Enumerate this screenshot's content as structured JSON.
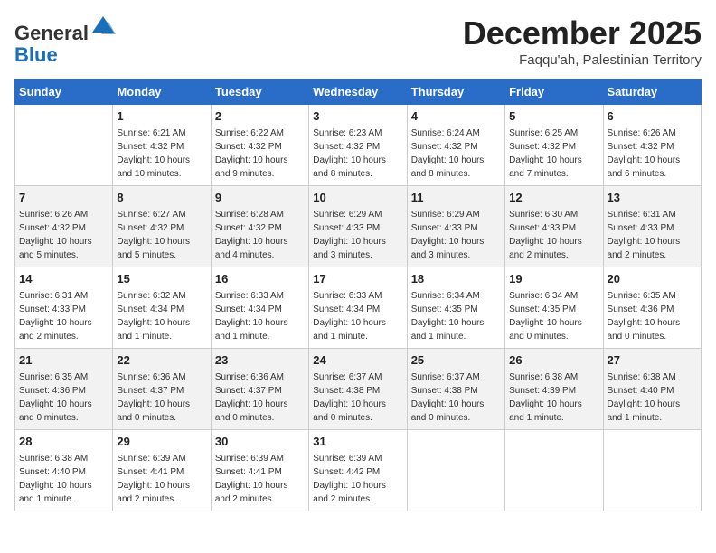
{
  "header": {
    "logo_general": "General",
    "logo_blue": "Blue",
    "month_title": "December 2025",
    "location": "Faqqu'ah, Palestinian Territory"
  },
  "columns": [
    "Sunday",
    "Monday",
    "Tuesday",
    "Wednesday",
    "Thursday",
    "Friday",
    "Saturday"
  ],
  "weeks": [
    {
      "days": [
        {
          "num": "",
          "info": ""
        },
        {
          "num": "1",
          "info": "Sunrise: 6:21 AM\nSunset: 4:32 PM\nDaylight: 10 hours\nand 10 minutes."
        },
        {
          "num": "2",
          "info": "Sunrise: 6:22 AM\nSunset: 4:32 PM\nDaylight: 10 hours\nand 9 minutes."
        },
        {
          "num": "3",
          "info": "Sunrise: 6:23 AM\nSunset: 4:32 PM\nDaylight: 10 hours\nand 8 minutes."
        },
        {
          "num": "4",
          "info": "Sunrise: 6:24 AM\nSunset: 4:32 PM\nDaylight: 10 hours\nand 8 minutes."
        },
        {
          "num": "5",
          "info": "Sunrise: 6:25 AM\nSunset: 4:32 PM\nDaylight: 10 hours\nand 7 minutes."
        },
        {
          "num": "6",
          "info": "Sunrise: 6:26 AM\nSunset: 4:32 PM\nDaylight: 10 hours\nand 6 minutes."
        }
      ]
    },
    {
      "days": [
        {
          "num": "7",
          "info": "Sunrise: 6:26 AM\nSunset: 4:32 PM\nDaylight: 10 hours\nand 5 minutes."
        },
        {
          "num": "8",
          "info": "Sunrise: 6:27 AM\nSunset: 4:32 PM\nDaylight: 10 hours\nand 5 minutes."
        },
        {
          "num": "9",
          "info": "Sunrise: 6:28 AM\nSunset: 4:32 PM\nDaylight: 10 hours\nand 4 minutes."
        },
        {
          "num": "10",
          "info": "Sunrise: 6:29 AM\nSunset: 4:33 PM\nDaylight: 10 hours\nand 3 minutes."
        },
        {
          "num": "11",
          "info": "Sunrise: 6:29 AM\nSunset: 4:33 PM\nDaylight: 10 hours\nand 3 minutes."
        },
        {
          "num": "12",
          "info": "Sunrise: 6:30 AM\nSunset: 4:33 PM\nDaylight: 10 hours\nand 2 minutes."
        },
        {
          "num": "13",
          "info": "Sunrise: 6:31 AM\nSunset: 4:33 PM\nDaylight: 10 hours\nand 2 minutes."
        }
      ]
    },
    {
      "days": [
        {
          "num": "14",
          "info": "Sunrise: 6:31 AM\nSunset: 4:33 PM\nDaylight: 10 hours\nand 2 minutes."
        },
        {
          "num": "15",
          "info": "Sunrise: 6:32 AM\nSunset: 4:34 PM\nDaylight: 10 hours\nand 1 minute."
        },
        {
          "num": "16",
          "info": "Sunrise: 6:33 AM\nSunset: 4:34 PM\nDaylight: 10 hours\nand 1 minute."
        },
        {
          "num": "17",
          "info": "Sunrise: 6:33 AM\nSunset: 4:34 PM\nDaylight: 10 hours\nand 1 minute."
        },
        {
          "num": "18",
          "info": "Sunrise: 6:34 AM\nSunset: 4:35 PM\nDaylight: 10 hours\nand 1 minute."
        },
        {
          "num": "19",
          "info": "Sunrise: 6:34 AM\nSunset: 4:35 PM\nDaylight: 10 hours\nand 0 minutes."
        },
        {
          "num": "20",
          "info": "Sunrise: 6:35 AM\nSunset: 4:36 PM\nDaylight: 10 hours\nand 0 minutes."
        }
      ]
    },
    {
      "days": [
        {
          "num": "21",
          "info": "Sunrise: 6:35 AM\nSunset: 4:36 PM\nDaylight: 10 hours\nand 0 minutes."
        },
        {
          "num": "22",
          "info": "Sunrise: 6:36 AM\nSunset: 4:37 PM\nDaylight: 10 hours\nand 0 minutes."
        },
        {
          "num": "23",
          "info": "Sunrise: 6:36 AM\nSunset: 4:37 PM\nDaylight: 10 hours\nand 0 minutes."
        },
        {
          "num": "24",
          "info": "Sunrise: 6:37 AM\nSunset: 4:38 PM\nDaylight: 10 hours\nand 0 minutes."
        },
        {
          "num": "25",
          "info": "Sunrise: 6:37 AM\nSunset: 4:38 PM\nDaylight: 10 hours\nand 0 minutes."
        },
        {
          "num": "26",
          "info": "Sunrise: 6:38 AM\nSunset: 4:39 PM\nDaylight: 10 hours\nand 1 minute."
        },
        {
          "num": "27",
          "info": "Sunrise: 6:38 AM\nSunset: 4:40 PM\nDaylight: 10 hours\nand 1 minute."
        }
      ]
    },
    {
      "days": [
        {
          "num": "28",
          "info": "Sunrise: 6:38 AM\nSunset: 4:40 PM\nDaylight: 10 hours\nand 1 minute."
        },
        {
          "num": "29",
          "info": "Sunrise: 6:39 AM\nSunset: 4:41 PM\nDaylight: 10 hours\nand 2 minutes."
        },
        {
          "num": "30",
          "info": "Sunrise: 6:39 AM\nSunset: 4:41 PM\nDaylight: 10 hours\nand 2 minutes."
        },
        {
          "num": "31",
          "info": "Sunrise: 6:39 AM\nSunset: 4:42 PM\nDaylight: 10 hours\nand 2 minutes."
        },
        {
          "num": "",
          "info": ""
        },
        {
          "num": "",
          "info": ""
        },
        {
          "num": "",
          "info": ""
        }
      ]
    }
  ]
}
